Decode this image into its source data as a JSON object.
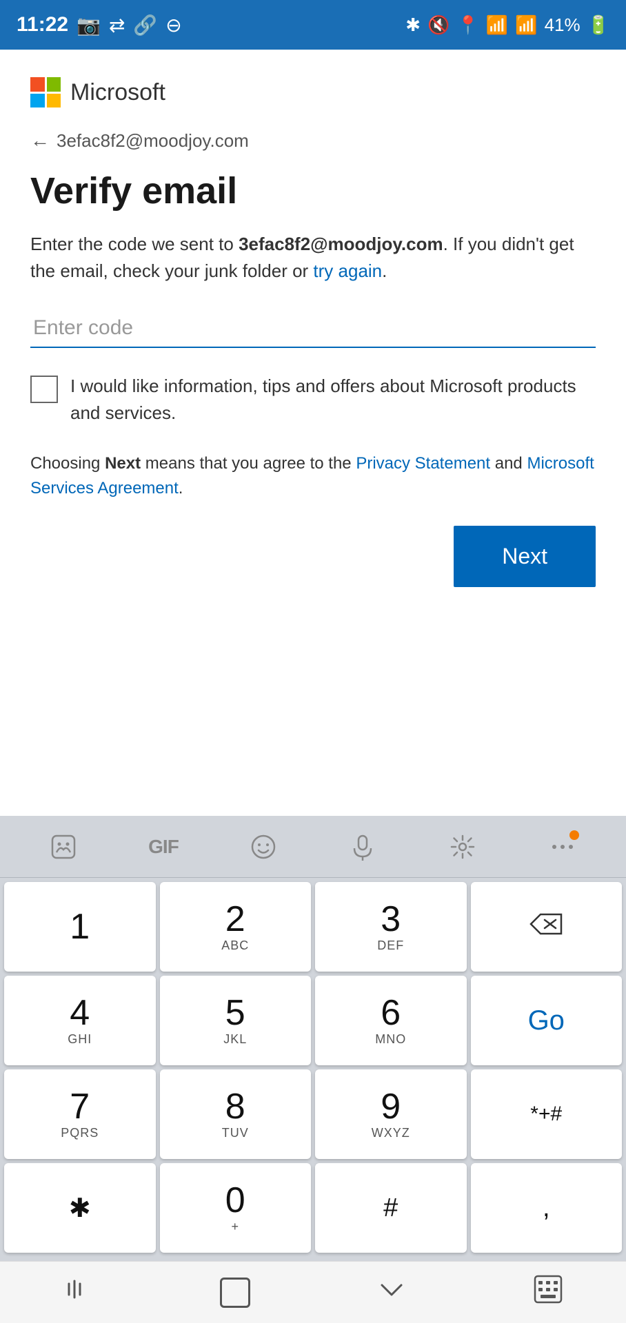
{
  "statusBar": {
    "time": "11:22",
    "battery": "41%",
    "signal": "●●●●",
    "wifi": "WiFi"
  },
  "logo": {
    "text": "Microsoft"
  },
  "backLink": {
    "email": "3efac8f2@moodjoy.com"
  },
  "page": {
    "title": "Verify email",
    "description_start": "Enter the code we sent to ",
    "email_bold": "3efac8f2@moodjoy.com",
    "description_middle": ". If you didn't get the email, check your junk folder or ",
    "try_again": "try again",
    "description_end": "."
  },
  "codeInput": {
    "placeholder": "Enter code"
  },
  "checkbox": {
    "label": "I would like information, tips and offers about Microsoft products and services."
  },
  "agreement": {
    "prefix": "Choosing ",
    "bold": "Next",
    "middle": " means that you agree to the ",
    "privacy_link": "Privacy Statement",
    "and": " and ",
    "services_link": "Microsoft Services Agreement",
    "suffix": "."
  },
  "nextButton": {
    "label": "Next"
  },
  "keyboard": {
    "toolbar": {
      "icons": [
        "sticker",
        "gif",
        "emoji",
        "microphone",
        "settings",
        "more"
      ]
    },
    "keys": [
      {
        "number": "1",
        "letters": "",
        "special": false
      },
      {
        "number": "2",
        "letters": "ABC",
        "special": false
      },
      {
        "number": "3",
        "letters": "DEF",
        "special": false
      },
      {
        "number": "backspace",
        "letters": "",
        "special": true
      },
      {
        "number": "4",
        "letters": "GHI",
        "special": false
      },
      {
        "number": "5",
        "letters": "JKL",
        "special": false
      },
      {
        "number": "6",
        "letters": "MNO",
        "special": false
      },
      {
        "number": "Go",
        "letters": "",
        "special": true
      },
      {
        "number": "7",
        "letters": "PQRS",
        "special": false
      },
      {
        "number": "8",
        "letters": "TUV",
        "special": false
      },
      {
        "number": "9",
        "letters": "WXYZ",
        "special": false
      },
      {
        "number": "*+#",
        "letters": "",
        "special": true
      },
      {
        "number": "*",
        "letters": "",
        "special": false
      },
      {
        "number": "0",
        "letters": "+",
        "special": false
      },
      {
        "number": "#",
        "letters": "",
        "special": false
      },
      {
        "number": ",",
        "letters": "",
        "special": false
      }
    ]
  },
  "bottomNav": {
    "back": "|||",
    "home": "□",
    "recent": "∨",
    "grid": "⊞"
  }
}
